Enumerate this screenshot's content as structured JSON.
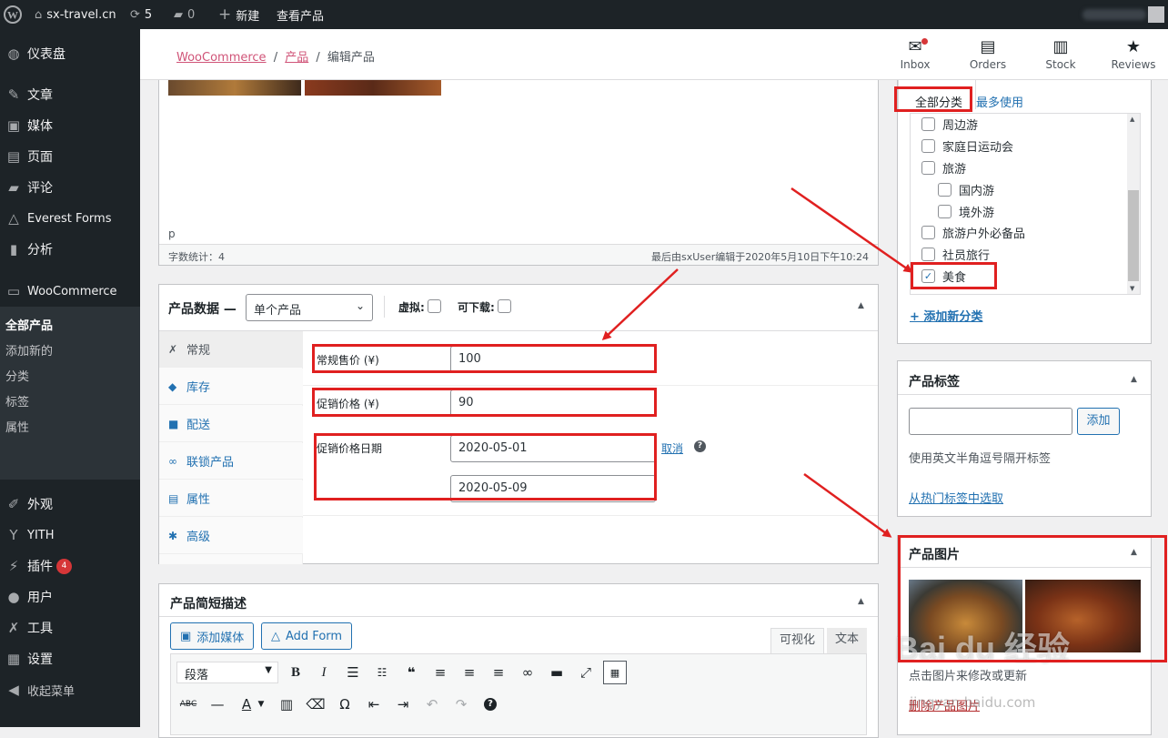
{
  "adminbar": {
    "site": "sx-travel.cn",
    "updates": "5",
    "comments": "0",
    "new": "新建",
    "view": "查看产品"
  },
  "menu": {
    "dashboard": "仪表盘",
    "posts": "文章",
    "media": "媒体",
    "pages": "页面",
    "comments": "评论",
    "everest": "Everest Forms",
    "analytics": "分析",
    "woocommerce": "WooCommerce",
    "products": "产品",
    "sub": [
      "全部产品",
      "添加新的",
      "分类",
      "标签",
      "属性"
    ],
    "appearance": "外观",
    "yith": "YITH",
    "plugins": "插件",
    "plugins_badge": "4",
    "users": "用户",
    "tools": "工具",
    "settings": "设置",
    "collapse": "收起菜单"
  },
  "header": {
    "crumb1": "WooCommerce",
    "crumb2": "产品",
    "crumb3": "编辑产品",
    "sep": "/",
    "inbox": "Inbox",
    "orders": "Orders",
    "stock": "Stock",
    "reviews": "Reviews"
  },
  "editor": {
    "path": "p",
    "wordcount": "字数统计：4",
    "lastedit": "最后由sxUser编辑于2020年5月10日下午10:24"
  },
  "productdata": {
    "title": "产品数据 —",
    "type": "单个产品",
    "virtual": "虚拟:",
    "downloadable": "可下载:",
    "tabs": [
      "常规",
      "库存",
      "配送",
      "联锁产品",
      "属性",
      "高级"
    ],
    "regular_label": "常规售价 (¥)",
    "regular_value": "100",
    "sale_label": "促销价格 (¥)",
    "sale_value": "90",
    "dates_label": "促销价格日期",
    "date_from": "2020-05-01",
    "date_to": "2020-05-09",
    "cancel": "取消"
  },
  "shortdesc": {
    "title": "产品简短描述",
    "add_media": "添加媒体",
    "add_form": "Add Form",
    "visual": "可视化",
    "text": "文本",
    "format": "段落"
  },
  "categories": {
    "tab_all": "全部分类",
    "tab_popular": "最多使用",
    "items": [
      "周边游",
      "家庭日运动会",
      "旅游",
      "国内游",
      "境外游",
      "旅游户外必备品",
      "社员旅行",
      "美食"
    ],
    "add_new": "+ 添加新分类"
  },
  "tags": {
    "title": "产品标签",
    "add": "添加",
    "hint": "使用英文半角逗号隔开标签",
    "choose": "从热门标签中选取"
  },
  "gallery": {
    "title": "产品图片",
    "hint": "点击图片来修改或更新",
    "remove": "删除产品图片"
  },
  "watermark": "Bai du 经验",
  "watermark2": "jingyan.baidu.com",
  "colors": {
    "accent": "#2271b1",
    "highlight": "#e02020",
    "woo": "#d05478",
    "adminbar": "#1d2327"
  }
}
